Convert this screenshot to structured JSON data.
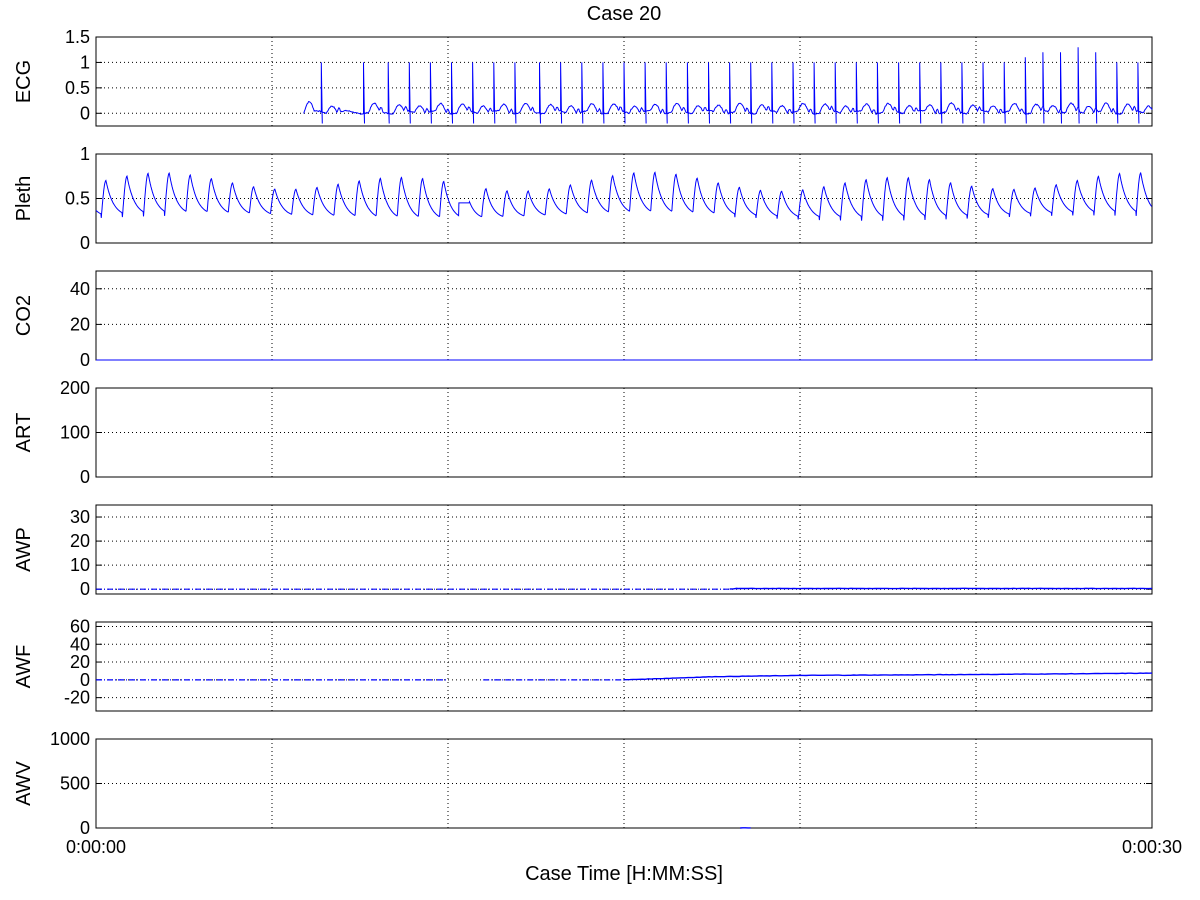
{
  "chart_data": {
    "type": "line",
    "title": "Case 20",
    "xlabel": "Case Time [H:MM:SS]",
    "x_tick_labels": [
      "0:00:00",
      "0:00:30"
    ],
    "xlim_seconds": [
      0,
      30
    ],
    "x_grid_seconds": [
      5,
      10,
      15,
      20,
      25
    ],
    "grid": true,
    "line_color": "#0000ff",
    "panels": [
      {
        "ylabel": "ECG",
        "ylim": [
          -0.25,
          1.5
        ],
        "yticks": [
          0,
          0.5,
          1,
          1.5
        ],
        "ytick_labels": [
          "0",
          "0.5",
          "1",
          "1.5"
        ],
        "signal": {
          "kind": "ecg",
          "start_s": 5.9,
          "r_peak_times_s": [
            6.4,
            7.6,
            8.3,
            8.9,
            9.5,
            10.1,
            10.7,
            11.3,
            11.9,
            12.6,
            13.2,
            13.8,
            14.4,
            15.0,
            15.6,
            16.2,
            16.8,
            17.4,
            18.0,
            18.6,
            19.2,
            19.8,
            20.4,
            21.0,
            21.6,
            22.2,
            22.8,
            23.4,
            24.0,
            24.6,
            25.2,
            25.8,
            26.4,
            26.9,
            27.4,
            27.9,
            28.4,
            29.0,
            29.6
          ],
          "r_peak_values": [
            1.0,
            1.0,
            1.0,
            1.0,
            1.0,
            1.0,
            1.0,
            1.0,
            1.0,
            1.0,
            1.0,
            1.0,
            1.0,
            1.0,
            1.0,
            1.0,
            1.0,
            1.0,
            1.0,
            1.0,
            1.0,
            1.0,
            1.0,
            1.0,
            1.0,
            1.0,
            1.0,
            1.0,
            1.0,
            1.0,
            1.0,
            1.0,
            1.1,
            1.2,
            1.2,
            1.3,
            1.2,
            1.0,
            1.0
          ],
          "t_wave_value": 0.15,
          "baseline_value": -0.2
        }
      },
      {
        "ylabel": "Pleth",
        "ylim": [
          0,
          1
        ],
        "yticks": [
          0,
          0.5,
          1
        ],
        "ytick_labels": [
          "0",
          "0.5",
          "1"
        ],
        "signal": {
          "kind": "pleth",
          "beat_period_s": 0.6,
          "peak_value": 0.72,
          "trough_value": 0.28,
          "flat_segment_s": [
            10.3,
            10.6
          ],
          "flat_value": 0.45
        }
      },
      {
        "ylabel": "CO2",
        "ylim": [
          0,
          50
        ],
        "yticks": [
          0,
          20,
          40
        ],
        "ytick_labels": [
          "0",
          "20",
          "40"
        ],
        "signal": {
          "kind": "flat",
          "value": 0
        }
      },
      {
        "ylabel": "ART",
        "ylim": [
          0,
          200
        ],
        "yticks": [
          0,
          100,
          200
        ],
        "ytick_labels": [
          "0",
          "100",
          "200"
        ],
        "signal": {
          "kind": "none"
        }
      },
      {
        "ylabel": "AWP",
        "ylim": [
          -2,
          35
        ],
        "yticks": [
          0,
          10,
          20,
          30
        ],
        "ytick_labels": [
          "0",
          "10",
          "20",
          "30"
        ],
        "signal": {
          "kind": "segments",
          "dashed_until_s": 18,
          "points": [
            [
              0,
              0
            ],
            [
              18,
              0
            ],
            [
              18.2,
              0.3
            ],
            [
              30,
              0.3
            ]
          ]
        }
      },
      {
        "ylabel": "AWF",
        "ylim": [
          -35,
          65
        ],
        "yticks": [
          -20,
          0,
          20,
          40,
          60
        ],
        "ytick_labels": [
          "-20",
          "0",
          "20",
          "40",
          "60"
        ],
        "signal": {
          "kind": "segments",
          "dashed_until_s": 15,
          "gap_s": [
            10,
            11
          ],
          "points": [
            [
              0,
              0
            ],
            [
              15,
              0
            ],
            [
              17.5,
              3.5
            ],
            [
              20,
              5
            ],
            [
              25,
              6
            ],
            [
              30,
              7.5
            ]
          ]
        }
      },
      {
        "ylabel": "AWV",
        "ylim": [
          0,
          1000
        ],
        "yticks": [
          0,
          500,
          1000
        ],
        "ytick_labels": [
          "0",
          "500",
          "1000"
        ],
        "signal": {
          "kind": "segments",
          "dashed_until_s": 0,
          "points": [
            [
              18.3,
              0
            ],
            [
              18.6,
              0
            ]
          ]
        }
      }
    ]
  }
}
